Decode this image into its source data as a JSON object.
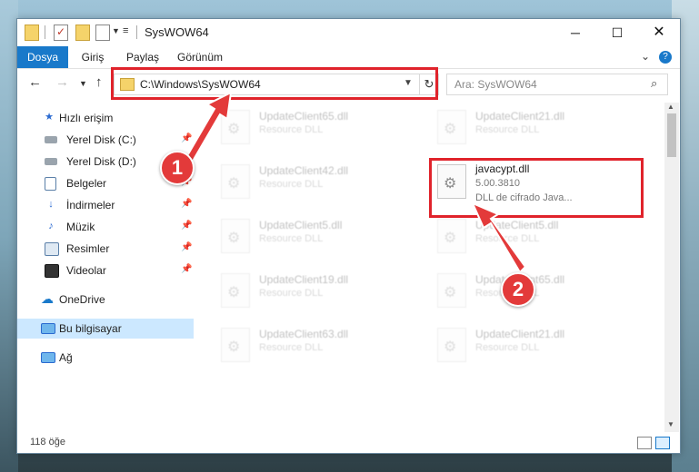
{
  "window": {
    "title": "SysWOW64"
  },
  "ribbon": {
    "tabs": [
      "Dosya",
      "Giriş",
      "Paylaş",
      "Görünüm"
    ]
  },
  "address": {
    "path": "C:\\Windows\\SysWOW64"
  },
  "search": {
    "placeholder": "Ara: SysWOW64"
  },
  "sidebar": {
    "items": [
      {
        "label": "Hızlı erişim",
        "icon": "star-icon"
      },
      {
        "label": "Yerel Disk (C:)",
        "icon": "drive-icon",
        "pinned": true
      },
      {
        "label": "Yerel Disk (D:)",
        "icon": "drive-icon",
        "pinned": true
      },
      {
        "label": "Belgeler",
        "icon": "documents-icon",
        "pinned": true
      },
      {
        "label": "İndirmeler",
        "icon": "downloads-icon",
        "pinned": true
      },
      {
        "label": "Müzik",
        "icon": "music-icon",
        "pinned": true
      },
      {
        "label": "Resimler",
        "icon": "pictures-icon",
        "pinned": true
      },
      {
        "label": "Videolar",
        "icon": "videos-icon",
        "pinned": true
      },
      {
        "label": "OneDrive",
        "icon": "cloud-icon"
      },
      {
        "label": "Bu bilgisayar",
        "icon": "computer-icon",
        "selected": true
      },
      {
        "label": "Ağ",
        "icon": "network-icon"
      }
    ]
  },
  "files": {
    "left": [
      {
        "name": "UpdateClient65.dll",
        "desc": "Resource DLL"
      },
      {
        "name": "UpdateClient42.dll",
        "desc": "Resource DLL"
      },
      {
        "name": "UpdateClient5.dll",
        "desc": "Resource DLL"
      },
      {
        "name": "UpdateClient19.dll",
        "desc": "Resource DLL"
      },
      {
        "name": "UpdateClient63.dll",
        "desc": "Resource DLL"
      }
    ],
    "right": [
      {
        "name": "UpdateClient21.dll",
        "desc": "Resource DLL"
      },
      {
        "name": "javacypt.dll",
        "version": "5.00.3810",
        "desc": "DLL de cifrado Java..."
      },
      {
        "name": "UpdateClient5.dll",
        "desc": "Resource DLL"
      },
      {
        "name": "UpdateClient65.dll",
        "desc": "Resource DLL"
      },
      {
        "name": "UpdateClient21.dll",
        "desc": "Resource DLL"
      }
    ]
  },
  "status": {
    "count": "118 öğe"
  },
  "annotations": {
    "step1": "1",
    "step2": "2",
    "color": "#e0232b"
  }
}
